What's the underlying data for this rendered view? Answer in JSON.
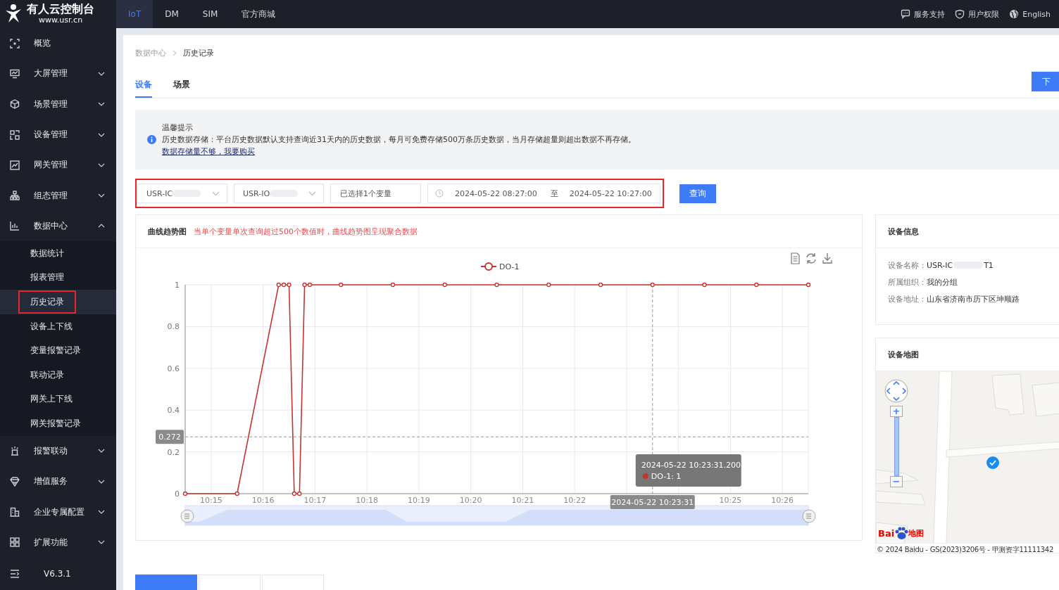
{
  "header": {
    "logo_title": "有人云控制台",
    "logo_url": "www.usr.cn",
    "tabs": [
      {
        "label": "IoT",
        "selected": true
      },
      {
        "label": "DM",
        "selected": false
      },
      {
        "label": "SIM",
        "selected": false
      },
      {
        "label": "官方商城",
        "selected": false
      }
    ],
    "links": [
      {
        "label": "服务支持",
        "kind": "chat"
      },
      {
        "label": "用户权限",
        "kind": "shield"
      },
      {
        "label": "English",
        "kind": "globe"
      }
    ]
  },
  "sidebar": {
    "items": [
      {
        "label": "概览",
        "kind": "focus"
      },
      {
        "label": "大屏管理",
        "kind": "monitor",
        "expanded": false
      },
      {
        "label": "场景管理",
        "kind": "cube",
        "expanded": false
      },
      {
        "label": "设备管理",
        "kind": "grid",
        "expanded": false
      },
      {
        "label": "网关管理",
        "kind": "chart",
        "expanded": false
      },
      {
        "label": "组态管理",
        "kind": "tree",
        "expanded": false
      },
      {
        "label": "数据中心",
        "kind": "bars",
        "expanded": true,
        "children": [
          {
            "label": "数据统计",
            "selected": false,
            "highlighted": false
          },
          {
            "label": "报表管理",
            "selected": false,
            "highlighted": false
          },
          {
            "label": "历史记录",
            "selected": true,
            "highlighted": true
          },
          {
            "label": "设备上下线",
            "selected": false,
            "highlighted": false
          },
          {
            "label": "变量报警记录",
            "selected": false,
            "highlighted": false
          },
          {
            "label": "联动记录",
            "selected": false,
            "highlighted": false
          },
          {
            "label": "网关上下线",
            "selected": false,
            "highlighted": false
          },
          {
            "label": "网关报警记录",
            "selected": false,
            "highlighted": false
          }
        ]
      },
      {
        "label": "报警联动",
        "kind": "alarm",
        "expanded": false
      },
      {
        "label": "增值服务",
        "kind": "gem",
        "expanded": false
      },
      {
        "label": "企业专属配置",
        "kind": "building",
        "expanded": false
      },
      {
        "label": "扩展功能",
        "kind": "apps",
        "expanded": false
      }
    ],
    "version": "V6.3.1"
  },
  "breadcrumb": [
    "数据中心",
    "历史记录"
  ],
  "tabs": [
    {
      "label": "设备",
      "selected": true
    },
    {
      "label": "场景",
      "selected": false
    }
  ],
  "corner_button": "下",
  "notice": {
    "title": "温馨提示",
    "text": "历史数据存储：平台历史数据默认支持查询近31天内的历史数据，每月可免费存储500万条历史数据，当月存储超量则超出数据不再存储。",
    "link": "数据存储量不够，我要购买"
  },
  "filter": {
    "highlighted": true,
    "selects": [
      {
        "value": "USR-IC",
        "redacted": true
      },
      {
        "value": "USR-IO",
        "redacted": true
      }
    ],
    "variables": "已选择1个变量",
    "date_start": "2024-05-22 08:27:00",
    "date_separator": "至",
    "date_end": "2024-05-22 10:27:00",
    "query_button": "查询"
  },
  "trend": {
    "title": "曲线趋势图",
    "note": "当单个变量单次查询超过500个数值时，曲线趋势图呈现聚合数据",
    "chart_data": {
      "type": "line",
      "categories": [
        null,
        null,
        null,
        null,
        null,
        "10:15",
        null,
        null,
        null,
        null,
        null,
        null,
        null,
        null,
        null,
        "10:16",
        null,
        null,
        null,
        null,
        null,
        null,
        null,
        null,
        null,
        "10:17",
        null,
        null,
        null,
        null,
        null,
        null,
        null,
        null,
        null,
        "10:18",
        null,
        null,
        null,
        null,
        null,
        null,
        null,
        null,
        null,
        "10:19",
        null,
        null,
        null,
        null,
        null,
        null,
        null,
        null,
        null,
        "10:20",
        null,
        null,
        null,
        null,
        null,
        null,
        null,
        null,
        null,
        "10:21",
        null,
        null,
        null,
        null,
        null,
        null,
        null,
        null,
        null,
        "10:22",
        null,
        null,
        null,
        null,
        null,
        null,
        null,
        null,
        null,
        null,
        null,
        null,
        null,
        null,
        null,
        null,
        null,
        null,
        null,
        null,
        null,
        null,
        null,
        null,
        null,
        null,
        null,
        null,
        null,
        "10:25",
        null,
        null,
        null,
        null,
        null,
        null,
        null,
        null,
        null,
        "10:26",
        null,
        null,
        null,
        null,
        null
      ],
      "grid": true,
      "ref_lines": [
        {
          "axis": "y",
          "value": 0.272,
          "label": "0.272"
        }
      ],
      "series": [
        {
          "name": "DO-1",
          "color": "#c23531",
          "marker": true,
          "values": [
            0,
            null,
            null,
            null,
            null,
            null,
            null,
            null,
            null,
            null,
            0,
            null,
            null,
            null,
            null,
            null,
            null,
            null,
            1,
            1,
            1,
            0,
            0,
            1,
            1,
            null,
            null,
            null,
            null,
            null,
            1,
            null,
            null,
            null,
            null,
            null,
            null,
            null,
            null,
            null,
            1,
            null,
            null,
            null,
            null,
            null,
            null,
            null,
            null,
            null,
            1,
            null,
            null,
            null,
            null,
            null,
            null,
            null,
            null,
            null,
            1,
            null,
            null,
            null,
            null,
            null,
            null,
            null,
            null,
            null,
            1,
            null,
            null,
            null,
            null,
            null,
            null,
            null,
            null,
            null,
            1,
            null,
            null,
            null,
            null,
            null,
            null,
            null,
            null,
            null,
            1,
            null,
            null,
            null,
            null,
            null,
            null,
            null,
            null,
            null,
            1,
            null,
            null,
            null,
            null,
            null,
            null,
            null,
            null,
            null,
            1,
            null,
            null,
            null,
            null,
            null,
            null,
            null,
            null,
            null,
            1
          ]
        }
      ],
      "ylim": [
        0,
        1
      ],
      "yticks": [
        0,
        0.2,
        0.4,
        0.6,
        0.8,
        1
      ],
      "annotations": [
        "2024-05-22 10:23:31",
        "2024-05-22 10:23:31.200",
        "DO-1: 1"
      ]
    }
  },
  "device_info": {
    "title": "设备信息",
    "rows": [
      {
        "label": "设备名称：",
        "value": "USR-IC",
        "value_end": "T1",
        "redacted": true
      },
      {
        "label": "所属组织：",
        "value": "我的分组"
      },
      {
        "label": "设备地址：",
        "value": "山东省济南市历下区坤顺路"
      }
    ]
  },
  "device_map": {
    "title": "设备地图",
    "zoom_in": "+",
    "zoom_slider": {
      "level": 1
    },
    "zoom_out": "−",
    "logo_start": "Bai",
    "logo_end": "地图",
    "copyright": "© 2024 Baidu - GS(2023)3206号 - 甲测资字11111342"
  },
  "bottom_tabs": [
    {
      "selected": true
    },
    {
      "selected": false
    },
    {
      "selected": false
    }
  ]
}
